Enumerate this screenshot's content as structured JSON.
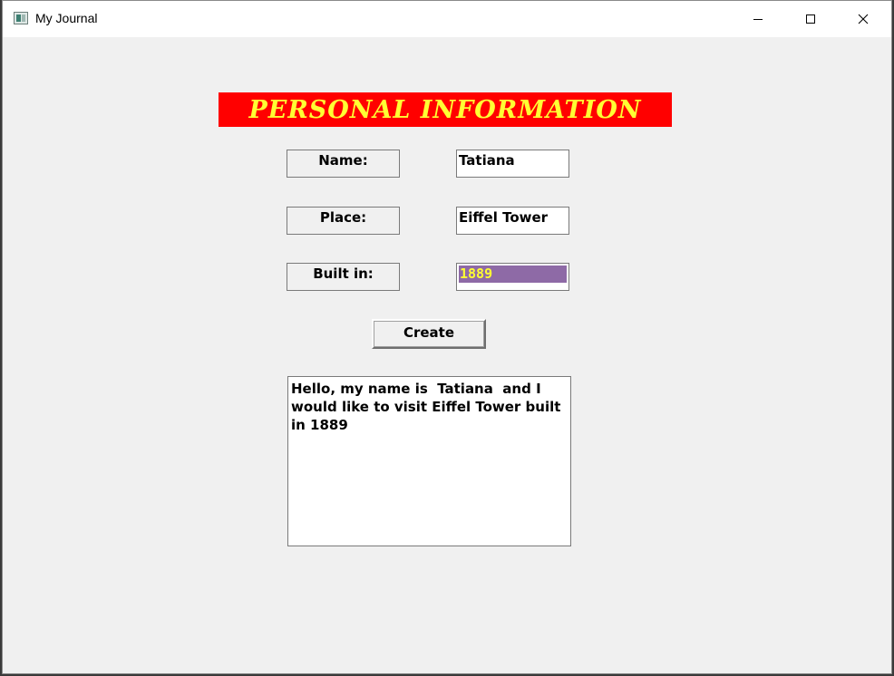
{
  "window": {
    "title": "My Journal"
  },
  "banner": {
    "text": "PERSONAL INFORMATION",
    "background": "#ff0000",
    "color": "#ffff33"
  },
  "form": {
    "name_label": "Name:",
    "name_value": "Tatiana",
    "place_label": "Place:",
    "place_value": "Eiffel Tower",
    "built_label": "Built in:",
    "built_value": "1889",
    "selection_color": "#8e6aa6"
  },
  "create_button": {
    "label": "Create"
  },
  "output": {
    "text": "Hello, my name is  Tatiana  and I would like to visit Eiffel Tower built in 1889"
  },
  "icons": {
    "app": "app-window-icon",
    "minimize": "minimize-icon",
    "maximize": "maximize-icon",
    "close": "close-icon"
  }
}
